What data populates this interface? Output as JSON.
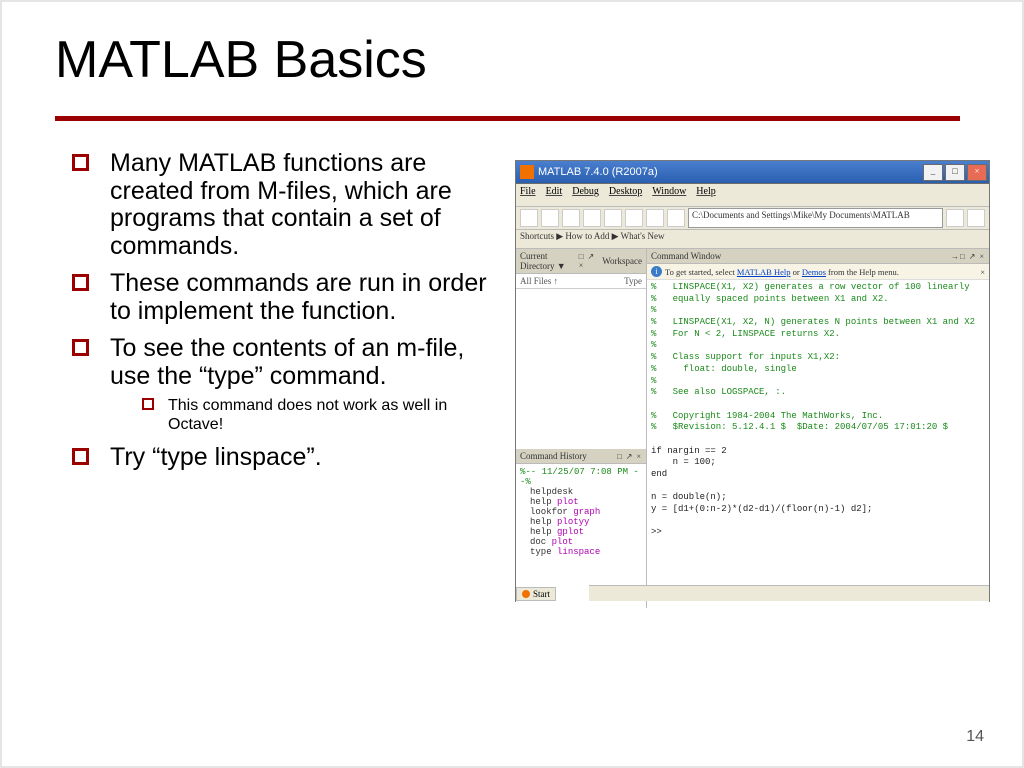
{
  "title": "MATLAB Basics",
  "page_number": "14",
  "bullets": [
    {
      "text": "Many MATLAB functions are created from M-files, which are programs that contain a set of commands."
    },
    {
      "text": "These commands are run in order to implement the function."
    },
    {
      "text": "To see the contents of an m-file, use the “type” command.",
      "sub": [
        "This command does not work as well in Octave!"
      ]
    },
    {
      "text": "Try “type linspace”."
    }
  ],
  "screenshot": {
    "window_title": "MATLAB 7.4.0 (R2007a)",
    "menu": [
      "File",
      "Edit",
      "Debug",
      "Desktop",
      "Window",
      "Help"
    ],
    "address": "C:\\Documents and Settings\\Mike\\My Documents\\MATLAB",
    "shortcuts": "Shortcuts   ▶ How to Add   ▶ What's New",
    "left_top_title": "Current Directory ▼",
    "left_top_tab": "Workspace",
    "dir_cols": [
      "All Files ↑",
      "Type"
    ],
    "history_title": "Command History",
    "history_date": "%-- 11/25/07  7:08 PM --%",
    "history_items": [
      "helpdesk",
      "help plot",
      "lookfor graph",
      "help plotyy",
      "help gplot",
      "doc plot",
      "type linspace"
    ],
    "cmd_title": "Command Window",
    "cmd_hint_pre": "To get started, select ",
    "cmd_hint_link1": "MATLAB Help",
    "cmd_hint_mid": " or ",
    "cmd_hint_link2": "Demos",
    "cmd_hint_post": " from the Help menu.",
    "cmd_lines": [
      "%   LINSPACE(X1, X2) generates a row vector of 100 linearly",
      "%   equally spaced points between X1 and X2.",
      "%",
      "%   LINSPACE(X1, X2, N) generates N points between X1 and X2",
      "%   For N < 2, LINSPACE returns X2.",
      "%",
      "%   Class support for inputs X1,X2:",
      "%     float: double, single",
      "%",
      "%   See also LOGSPACE, :.",
      "",
      "%   Copyright 1984-2004 The MathWorks, Inc.",
      "%   $Revision: 5.12.4.1 $  $Date: 2004/07/05 17:01:20 $",
      "",
      "if nargin == 2",
      "    n = 100;",
      "end",
      "",
      "n = double(n);",
      "y = [d1+(0:n-2)*(d2-d1)/(floor(n)-1) d2];",
      "",
      ">>"
    ],
    "start_label": "Start"
  }
}
